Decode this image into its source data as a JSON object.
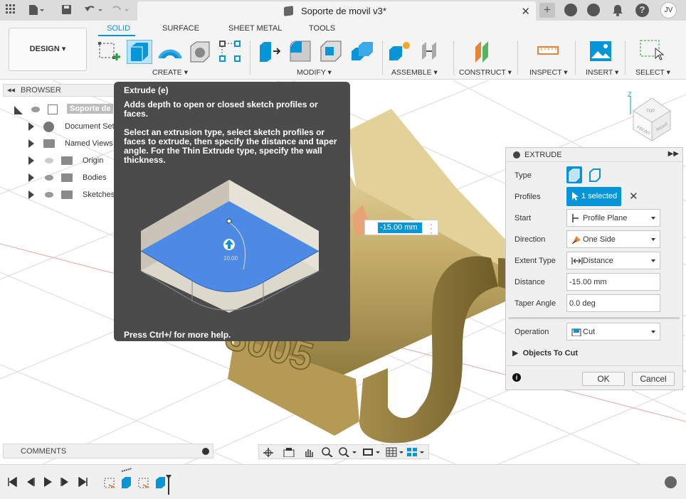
{
  "titlebar": {
    "document_title": "Soporte de movil v3*",
    "user_initials": "JV"
  },
  "toolbar": {
    "workspace": "DESIGN ▾",
    "tabs": [
      "SOLID",
      "SURFACE",
      "SHEET METAL",
      "TOOLS"
    ],
    "groups": {
      "create": "CREATE ▾",
      "modify": "MODIFY ▾",
      "assemble": "ASSEMBLE ▾",
      "construct": "CONSTRUCT ▾",
      "inspect": "INSPECT ▾",
      "insert": "INSERT ▾",
      "select": "SELECT ▾"
    }
  },
  "browser": {
    "title": "BROWSER",
    "items": [
      {
        "label": "Soporte de"
      },
      {
        "label": "Document Sett"
      },
      {
        "label": "Named Views"
      },
      {
        "label": "Origin"
      },
      {
        "label": "Bodies"
      },
      {
        "label": "Sketches"
      }
    ]
  },
  "tooltip": {
    "title": "Extrude (e)",
    "line1": "Adds depth to open or closed sketch profiles or faces.",
    "line2": "Select an extrusion type, select sketch profiles or faces to extrude, then specify the distance and taper angle. For the Thin Extrude type, specify the wall thickness.",
    "illustration_value": "10.00",
    "footer": "Press Ctrl+/ for more help."
  },
  "canvas": {
    "distance_input": "-15.00 mm",
    "engraved_text": "3005"
  },
  "extrude": {
    "title": "EXTRUDE",
    "rows": {
      "type": "Type",
      "profiles": "Profiles",
      "start": "Start",
      "direction": "Direction",
      "extent_type": "Extent Type",
      "distance": "Distance",
      "taper_angle": "Taper Angle",
      "operation": "Operation"
    },
    "profiles_value": "1 selected",
    "start_value": "Profile Plane",
    "direction_value": "One Side",
    "extent_value": "Distance",
    "distance_value": "-15.00 mm",
    "taper_value": "0.0 deg",
    "operation_value": "Cut",
    "objects_to_cut": "Objects To Cut",
    "ok": "OK",
    "cancel": "Cancel"
  },
  "viewcube": {
    "axis": "Z",
    "top": "TOP",
    "front": "FRONT",
    "right": "RIGHT"
  },
  "comments": {
    "title": "COMMENTS"
  },
  "colors": {
    "accent": "#0696d7",
    "tooltip_bg": "#4b4b4b",
    "model_gold": "#c8b273"
  }
}
